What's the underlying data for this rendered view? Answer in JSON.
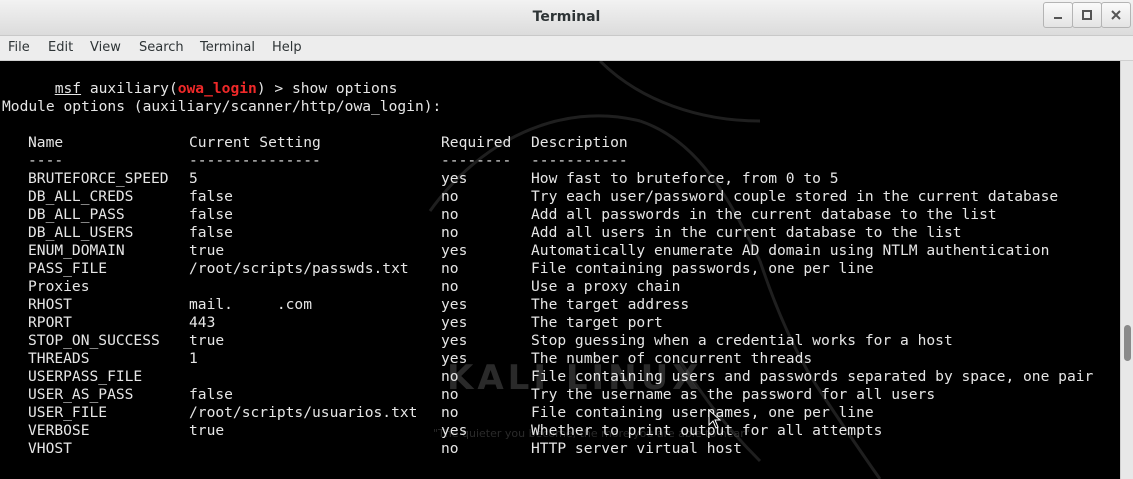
{
  "window": {
    "title": "Terminal"
  },
  "menu": [
    "File",
    "Edit",
    "View",
    "Search",
    "Terminal",
    "Help"
  ],
  "prompt": {
    "msf": "msf",
    "prefix": " auxiliary(",
    "module": "owa_login",
    "suffix": ") > ",
    "command": "show options"
  },
  "module_heading": "Module options (auxiliary/scanner/http/owa_login):",
  "table": {
    "headers": [
      "Name",
      "Current Setting",
      "Required",
      "Description"
    ],
    "separators": [
      "----",
      "---------------",
      "--------",
      "-----------"
    ],
    "rows": [
      [
        "BRUTEFORCE_SPEED",
        "5",
        "yes",
        "How fast to bruteforce, from 0 to 5"
      ],
      [
        "DB_ALL_CREDS",
        "false",
        "no",
        "Try each user/password couple stored in the current database"
      ],
      [
        "DB_ALL_PASS",
        "false",
        "no",
        "Add all passwords in the current database to the list"
      ],
      [
        "DB_ALL_USERS",
        "false",
        "no",
        "Add all users in the current database to the list"
      ],
      [
        "ENUM_DOMAIN",
        "true",
        "yes",
        "Automatically enumerate AD domain using NTLM authentication"
      ],
      [
        "PASS_FILE",
        "/root/scripts/passwds.txt",
        "no",
        "File containing passwords, one per line"
      ],
      [
        "Proxies",
        "",
        "no",
        "Use a proxy chain"
      ],
      [
        "RHOST",
        "mail.     .com",
        "yes",
        "The target address"
      ],
      [
        "RPORT",
        "443",
        "yes",
        "The target port"
      ],
      [
        "STOP_ON_SUCCESS",
        "true",
        "yes",
        "Stop guessing when a credential works for a host"
      ],
      [
        "THREADS",
        "1",
        "yes",
        "The number of concurrent threads"
      ],
      [
        "USERPASS_FILE",
        "",
        "no",
        "File containing users and passwords separated by space, one pair"
      ],
      [
        "USER_AS_PASS",
        "false",
        "no",
        "Try the username as the password for all users"
      ],
      [
        "USER_FILE",
        "/root/scripts/usuarios.txt",
        "no",
        "File containing usernames, one per line"
      ],
      [
        "VERBOSE",
        "true",
        "yes",
        "Whether to print output for all attempts"
      ],
      [
        "VHOST",
        "",
        "no",
        "HTTP server virtual host"
      ]
    ]
  },
  "watermark": {
    "title": "KALI LINUX",
    "subtitle": "\"The quieter you become, the more you are able to hear\""
  },
  "colors": {
    "background": "#000000",
    "text": "#e6e6e6",
    "module": "#ef2929"
  }
}
